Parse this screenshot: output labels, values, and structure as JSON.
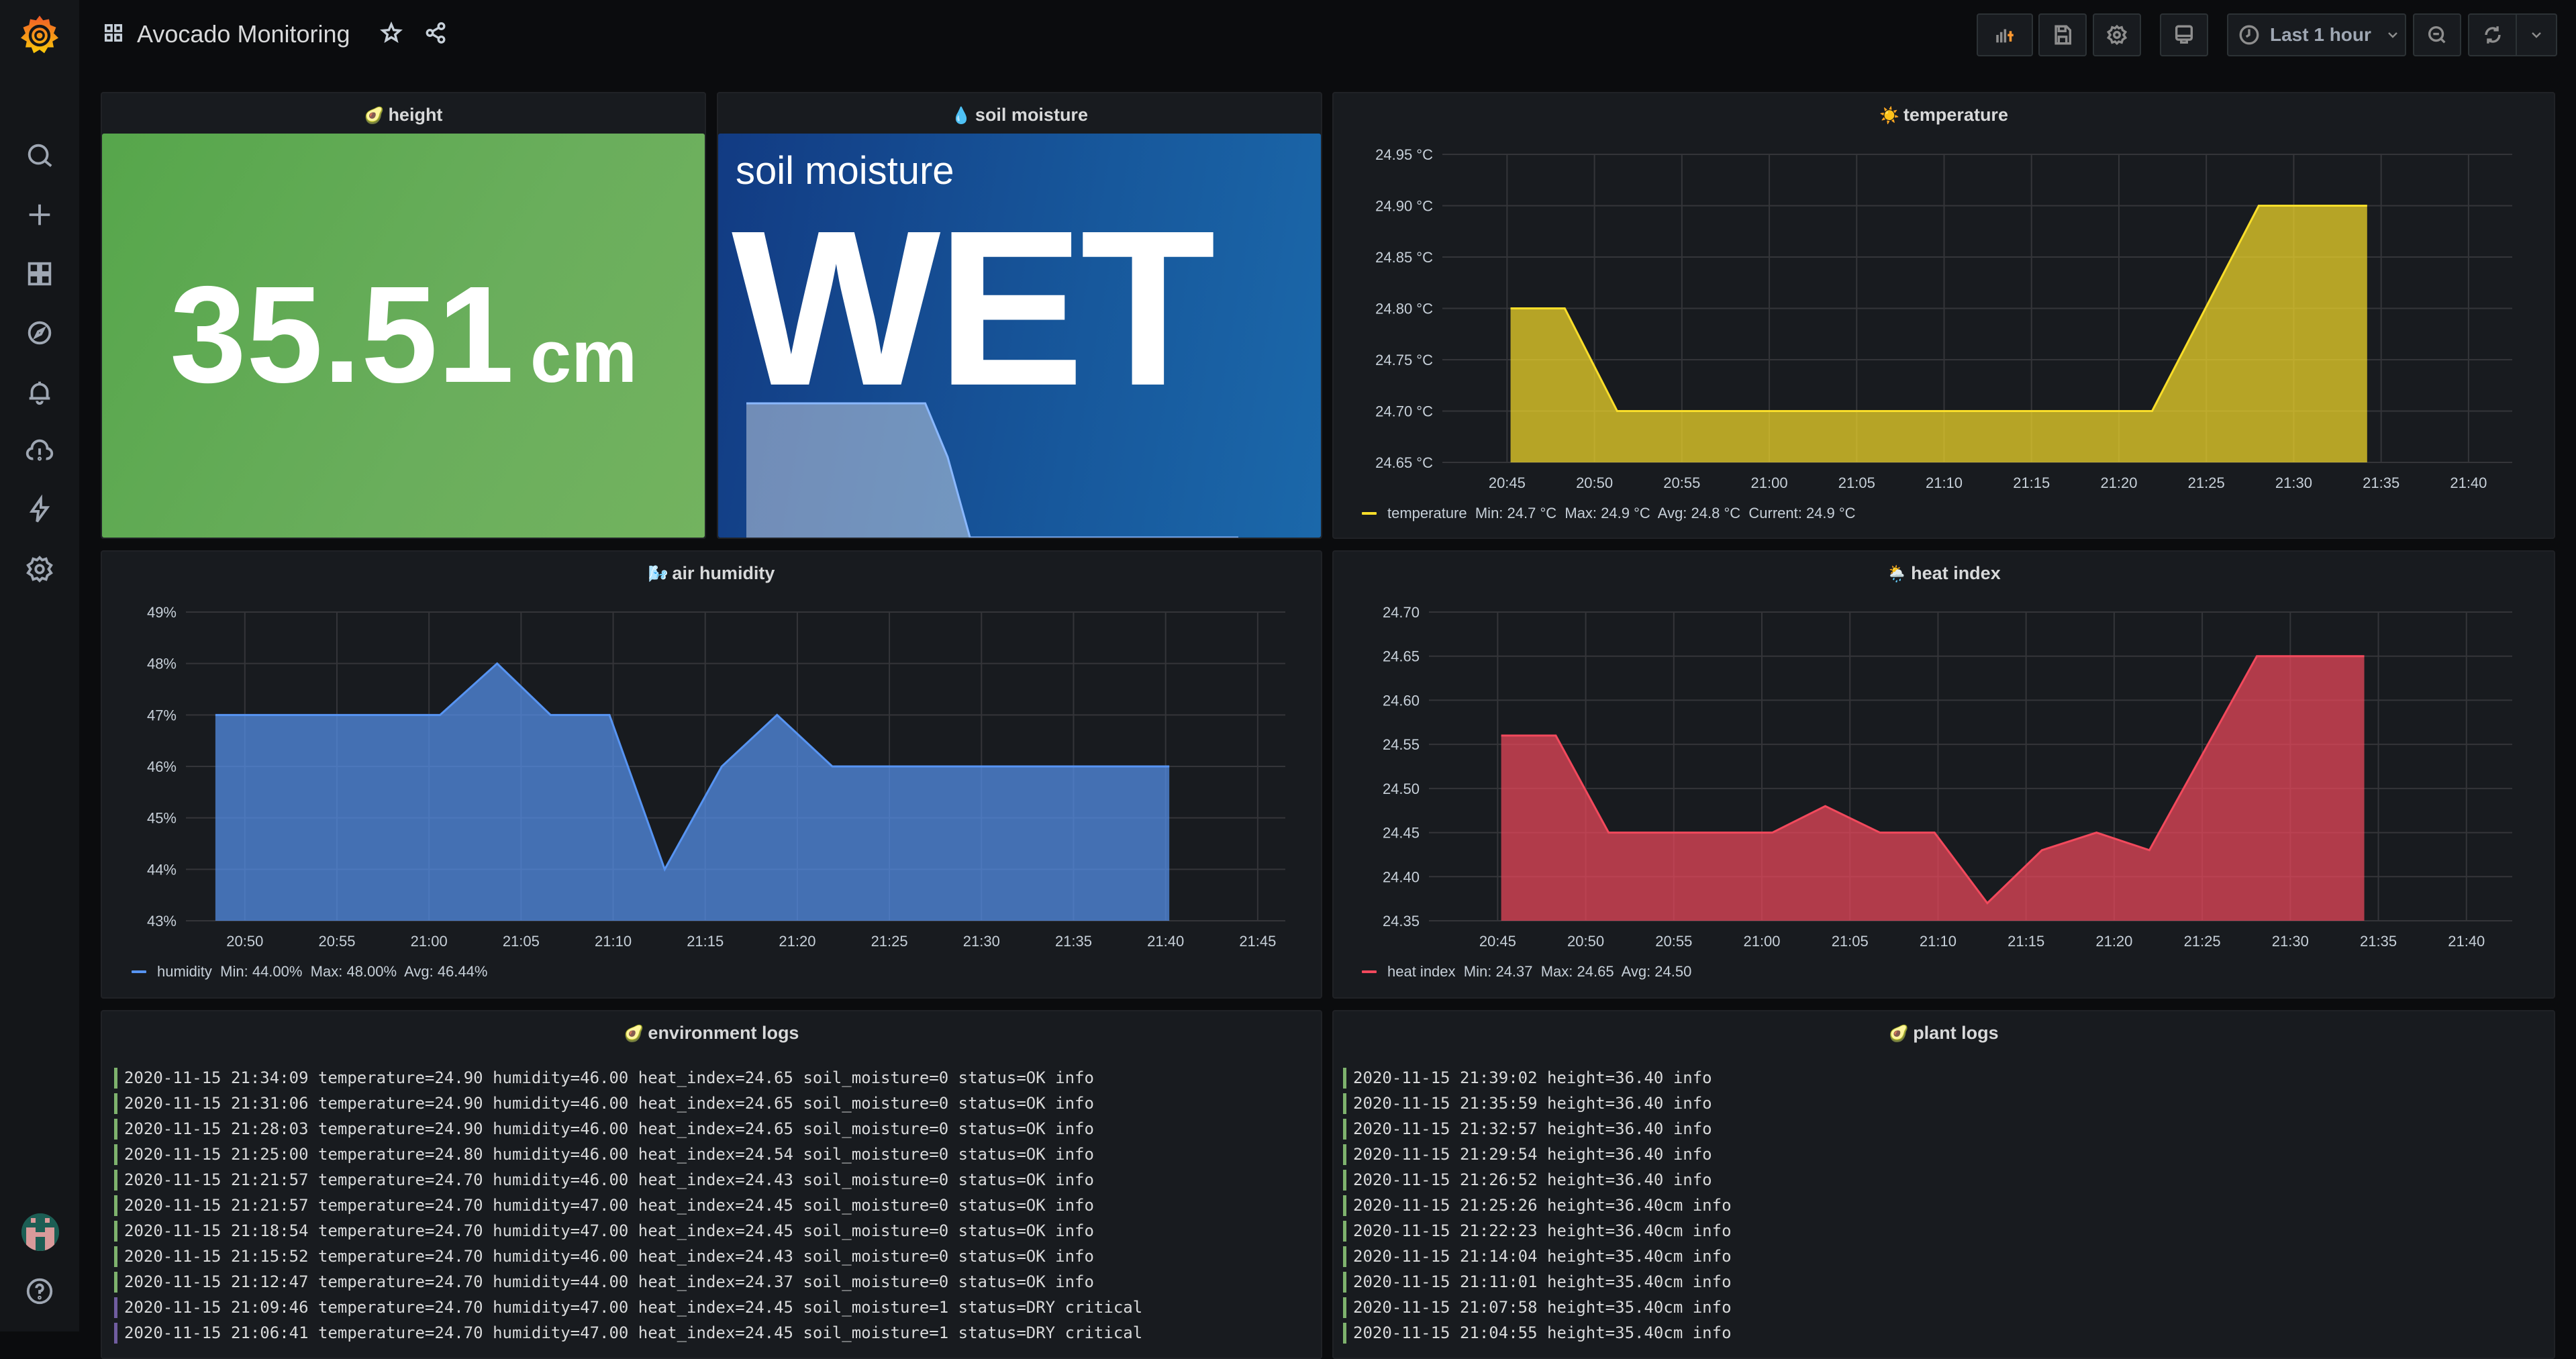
{
  "app": {
    "title": "Avocado Monitoring",
    "star_icon": "star-icon",
    "share_icon": "share-icon"
  },
  "sidebar": {
    "items": [
      {
        "name": "search",
        "icon": "search-icon"
      },
      {
        "name": "create",
        "icon": "plus-icon"
      },
      {
        "name": "dashboards",
        "icon": "apps-icon"
      },
      {
        "name": "explore",
        "icon": "compass-icon"
      },
      {
        "name": "alerting",
        "icon": "bell-icon"
      },
      {
        "name": "cloud-alert",
        "icon": "cloud-alert-icon"
      },
      {
        "name": "plugins",
        "icon": "bolt-icon"
      },
      {
        "name": "configuration",
        "icon": "gear-icon"
      }
    ],
    "bottom": [
      {
        "name": "profile",
        "icon": "avatar"
      },
      {
        "name": "help",
        "icon": "question-circle-icon"
      }
    ]
  },
  "toolbar": {
    "add_panel": "add-panel-icon",
    "save": "save-icon",
    "settings": "gear-icon",
    "tv_mode": "monitor-icon",
    "time_range": "Last 1 hour",
    "zoom_out": "zoom-out-icon",
    "refresh": "refresh-icon",
    "refresh_interval": "chevron-down-icon"
  },
  "panels": {
    "height": {
      "title": "height",
      "emoji": "🥑",
      "value": "35.51",
      "unit": "cm",
      "color": "#56a64b"
    },
    "soil": {
      "title": "soil moisture",
      "emoji": "💧",
      "label": "soil moisture",
      "value": "WET",
      "color": "#1f60c4",
      "sparkline": [
        1,
        1,
        1,
        1,
        1,
        1,
        1,
        1,
        1,
        0.6,
        0,
        0,
        0,
        0,
        0,
        0,
        0,
        0,
        0,
        0,
        0,
        0,
        0
      ]
    },
    "temperature": {
      "title": "temperature",
      "emoji": "☀️"
    },
    "humidity": {
      "title": "air humidity",
      "emoji": "🌬️"
    },
    "heat_index": {
      "title": "heat index",
      "emoji": "🌦️"
    },
    "env_logs": {
      "title": "environment logs",
      "emoji": "🥑",
      "rows": [
        {
          "level": "info",
          "text": "2020-11-15 21:34:09 temperature=24.90 humidity=46.00 heat_index=24.65 soil_moisture=0 status=OK info"
        },
        {
          "level": "info",
          "text": "2020-11-15 21:31:06 temperature=24.90 humidity=46.00 heat_index=24.65 soil_moisture=0 status=OK info"
        },
        {
          "level": "info",
          "text": "2020-11-15 21:28:03 temperature=24.90 humidity=46.00 heat_index=24.65 soil_moisture=0 status=OK info"
        },
        {
          "level": "info",
          "text": "2020-11-15 21:25:00 temperature=24.80 humidity=46.00 heat_index=24.54 soil_moisture=0 status=OK info"
        },
        {
          "level": "info",
          "text": "2020-11-15 21:21:57 temperature=24.70 humidity=46.00 heat_index=24.43 soil_moisture=0 status=OK info"
        },
        {
          "level": "info",
          "text": "2020-11-15 21:21:57 temperature=24.70 humidity=47.00 heat_index=24.45 soil_moisture=0 status=OK info"
        },
        {
          "level": "info",
          "text": "2020-11-15 21:18:54 temperature=24.70 humidity=47.00 heat_index=24.45 soil_moisture=0 status=OK info"
        },
        {
          "level": "info",
          "text": "2020-11-15 21:15:52 temperature=24.70 humidity=46.00 heat_index=24.43 soil_moisture=0 status=OK info"
        },
        {
          "level": "info",
          "text": "2020-11-15 21:12:47 temperature=24.70 humidity=44.00 heat_index=24.37 soil_moisture=0 status=OK info"
        },
        {
          "level": "critical",
          "text": "2020-11-15 21:09:46 temperature=24.70 humidity=47.00 heat_index=24.45 soil_moisture=1 status=DRY critical"
        },
        {
          "level": "critical",
          "text": "2020-11-15 21:06:41 temperature=24.70 humidity=47.00 heat_index=24.45 soil_moisture=1 status=DRY critical"
        }
      ]
    },
    "plant_logs": {
      "title": "plant logs",
      "emoji": "🥑",
      "rows": [
        {
          "level": "info",
          "text": "2020-11-15 21:39:02 height=36.40 info"
        },
        {
          "level": "info",
          "text": "2020-11-15 21:35:59 height=36.40 info"
        },
        {
          "level": "info",
          "text": "2020-11-15 21:32:57 height=36.40 info"
        },
        {
          "level": "info",
          "text": "2020-11-15 21:29:54 height=36.40 info"
        },
        {
          "level": "info",
          "text": "2020-11-15 21:26:52 height=36.40 info"
        },
        {
          "level": "info",
          "text": "2020-11-15 21:25:26 height=36.40cm info"
        },
        {
          "level": "info",
          "text": "2020-11-15 21:22:23 height=36.40cm info"
        },
        {
          "level": "info",
          "text": "2020-11-15 21:14:04 height=35.40cm info"
        },
        {
          "level": "info",
          "text": "2020-11-15 21:11:01 height=35.40cm info"
        },
        {
          "level": "info",
          "text": "2020-11-15 21:07:58 height=35.40cm info"
        },
        {
          "level": "info",
          "text": "2020-11-15 21:04:55 height=35.40cm info"
        }
      ]
    }
  },
  "colors": {
    "info": "#7eb26d",
    "critical": "#705da0",
    "temperature": "#fade2a",
    "humidity": "#5794f2",
    "heat_index": "#f2495c"
  },
  "chart_data": [
    {
      "id": "temperature",
      "type": "area",
      "title": "temperature",
      "xlabel": "",
      "ylabel": "",
      "x_ticks": [
        "20:45",
        "20:50",
        "20:55",
        "21:00",
        "21:05",
        "21:10",
        "21:15",
        "21:20",
        "21:25",
        "21:30",
        "21:35",
        "21:40"
      ],
      "xlim_minutes": [
        "20:41.3",
        "21:42.5"
      ],
      "y_ticks": [
        "24.65 °C",
        "24.70 °C",
        "24.75 °C",
        "24.80 °C",
        "24.85 °C",
        "24.90 °C",
        "24.95 °C"
      ],
      "ylim": [
        24.65,
        24.95
      ],
      "grid": true,
      "legend": "bottom-left",
      "series": [
        {
          "name": "temperature",
          "color": "#fade2a",
          "x": [
            "20:45.2",
            "20:48.3",
            "20:51.3",
            "21:21.9",
            "21:28.0",
            "21:34.2"
          ],
          "values": [
            24.8,
            24.8,
            24.7,
            24.7,
            24.9,
            24.9
          ],
          "stats": "Min: 24.7 °C  Max: 24.9 °C  Avg: 24.8 °C  Current: 24.9 °C"
        }
      ]
    },
    {
      "id": "humidity",
      "type": "area",
      "title": "air humidity",
      "x_ticks": [
        "20:50",
        "20:55",
        "21:00",
        "21:05",
        "21:10",
        "21:15",
        "21:20",
        "21:25",
        "21:30",
        "21:35",
        "21:40",
        "21:45"
      ],
      "xlim_minutes": [
        "20:46.8",
        "21:46.5"
      ],
      "y_ticks": [
        "43%",
        "44%",
        "45%",
        "46%",
        "47%",
        "48%",
        "49%"
      ],
      "ylim": [
        43,
        49
      ],
      "grid": true,
      "legend": "bottom-left",
      "series": [
        {
          "name": "humidity",
          "color": "#5794f2",
          "x": [
            "20:48.4",
            "21:00.6",
            "21:03.7",
            "21:06.6",
            "21:09.8",
            "21:12.8",
            "21:15.9",
            "21:18.9",
            "21:21.9",
            "21:40.2"
          ],
          "values": [
            47,
            47,
            48,
            47,
            47,
            44,
            46,
            47,
            46,
            46
          ],
          "stats": "Min: 44.00%  Max: 48.00%  Avg: 46.44%"
        }
      ]
    },
    {
      "id": "heat_index",
      "type": "area",
      "title": "heat index",
      "x_ticks": [
        "20:45",
        "20:50",
        "20:55",
        "21:00",
        "21:05",
        "21:10",
        "21:15",
        "21:20",
        "21:25",
        "21:30",
        "21:35",
        "21:40"
      ],
      "xlim_minutes": [
        "20:41.1",
        "21:42.6"
      ],
      "y_ticks": [
        "24.35",
        "24.40",
        "24.45",
        "24.50",
        "24.55",
        "24.60",
        "24.65",
        "24.70"
      ],
      "ylim": [
        24.35,
        24.7
      ],
      "grid": true,
      "legend": "bottom-left",
      "series": [
        {
          "name": "heat index",
          "color": "#f2495c",
          "x": [
            "20:45.2",
            "20:48.3",
            "20:51.3",
            "21:00.6",
            "21:03.6",
            "21:06.7",
            "21:09.8",
            "21:12.8",
            "21:15.9",
            "21:19.0",
            "21:22.0",
            "21:28.1",
            "21:34.2"
          ],
          "values": [
            24.56,
            24.56,
            24.45,
            24.45,
            24.48,
            24.45,
            24.45,
            24.37,
            24.43,
            24.45,
            24.43,
            24.65,
            24.65
          ],
          "stats": "Min: 24.37  Max: 24.65  Avg: 24.50"
        }
      ]
    }
  ]
}
